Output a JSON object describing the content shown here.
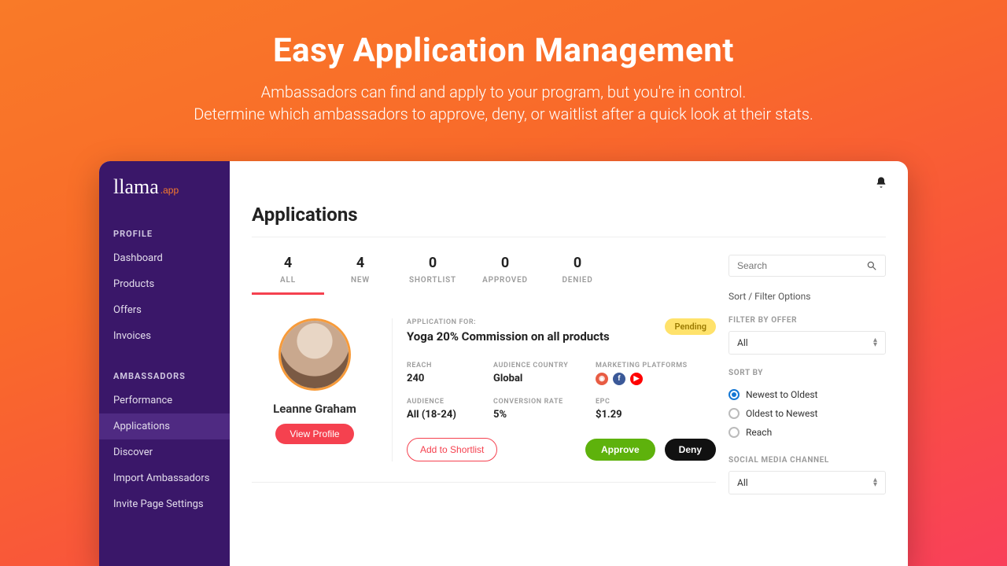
{
  "hero": {
    "title": "Easy Application Management",
    "line1": "Ambassadors can find and apply to your program, but you're in control.",
    "line2": "Determine which ambassadors to approve, deny, or waitlist after a quick look at their stats."
  },
  "brand": {
    "name": "llama",
    "suffix": ".app"
  },
  "sidebar": {
    "section1": "PROFILE",
    "section2": "AMBASSADORS",
    "items1": [
      "Dashboard",
      "Products",
      "Offers",
      "Invoices"
    ],
    "items2": [
      "Performance",
      "Applications",
      "Discover",
      "Import Ambassadors",
      "Invite Page Settings"
    ],
    "activeIndex2": 1
  },
  "page": {
    "title": "Applications"
  },
  "tabs": [
    {
      "count": "4",
      "label": "ALL"
    },
    {
      "count": "4",
      "label": "NEW"
    },
    {
      "count": "0",
      "label": "SHORTLIST"
    },
    {
      "count": "0",
      "label": "APPROVED"
    },
    {
      "count": "0",
      "label": "DENIED"
    }
  ],
  "activeTab": 0,
  "application": {
    "name": "Leanne Graham",
    "viewProfile": "View Profile",
    "status": "Pending",
    "appForLabel": "APPLICATION FOR:",
    "appFor": "Yoga 20% Commission on all products",
    "stats": {
      "reachLabel": "REACH",
      "reach": "240",
      "audienceCountryLabel": "AUDIENCE COUNTRY",
      "audienceCountry": "Global",
      "platformsLabel": "MARKETING PLATFORMS",
      "audienceLabel": "AUDIENCE",
      "audience": "All (18-24)",
      "conversionLabel": "CONVERSION RATE",
      "conversion": "5%",
      "epcLabel": "EPC",
      "epc": "$1.29"
    },
    "shortlist": "Add to Shortlist",
    "approve": "Approve",
    "deny": "Deny"
  },
  "filters": {
    "searchPlaceholder": "Search",
    "sortFilterTitle": "Sort / Filter Options",
    "filterByOfferLabel": "FILTER BY OFFER",
    "filterByOfferValue": "All",
    "sortByLabel": "SORT BY",
    "sortOptions": [
      "Newest to Oldest",
      "Oldest to Newest",
      "Reach"
    ],
    "sortSelected": 0,
    "socialLabel": "SOCIAL MEDIA CHANNEL",
    "socialValue": "All"
  }
}
